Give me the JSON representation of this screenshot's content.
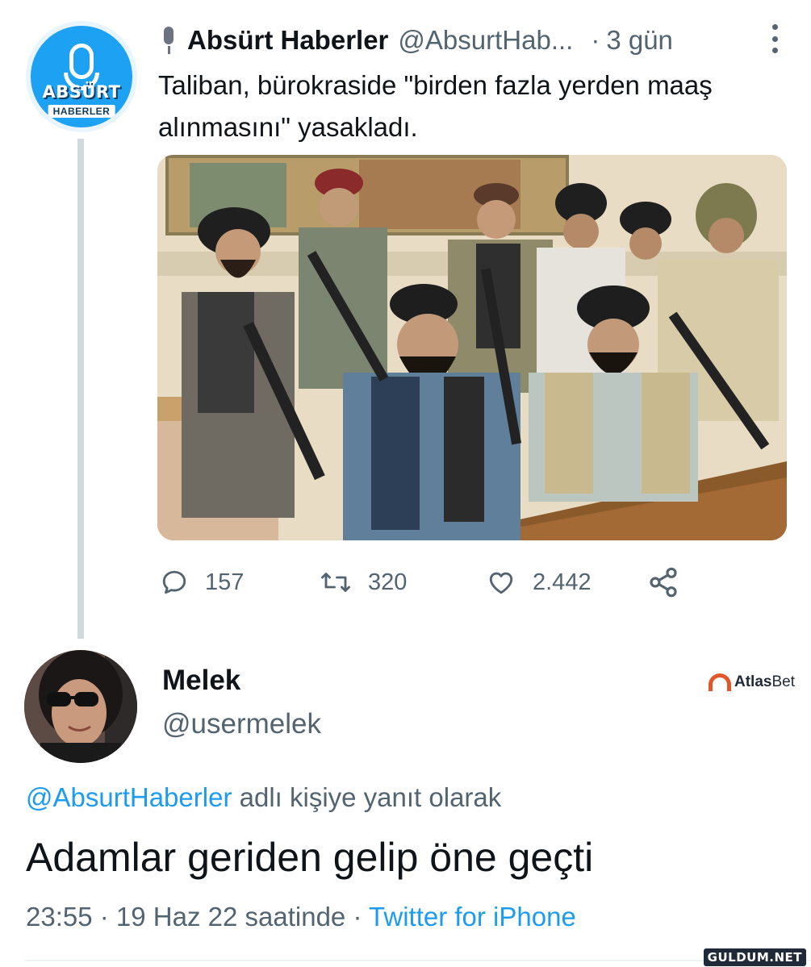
{
  "parent_tweet": {
    "author_name": "Absürt Haberler",
    "author_handle": "@AbsurtHab...",
    "time_separator": "·",
    "time_ago": "3 gün",
    "text": "Taliban, bürokraside \"birden fazla yerden maaş alınmasını\" yasakladı.",
    "avatar_logo_top": "ABSÜRT",
    "avatar_logo_bottom": "HABERLER",
    "actions": {
      "replies": "157",
      "retweets": "320",
      "likes": "2.442"
    }
  },
  "reply_tweet": {
    "author_name": "Melek",
    "author_handle": "@usermelek",
    "reply_to_mention": "@AbsurtHaberler",
    "reply_to_suffix": "adlı kişiye yanıt olarak",
    "text": "Adamlar geriden gelip öne geçti",
    "timestamp": "23:55 · 19 Haz 22 saatinde",
    "meta_separator": "·",
    "source": "Twitter for iPhone"
  },
  "brand_badge": {
    "part1": "Atlas",
    "part2": "Bet"
  },
  "watermark": "GULDUM.NET",
  "icons": {
    "reply": "reply-icon",
    "retweet": "retweet-icon",
    "like": "heart-icon",
    "share": "share-icon",
    "more": "more-icon"
  },
  "colors": {
    "link": "#1d9bf0",
    "secondary_text": "#536471",
    "primary_text": "#0f1419",
    "avatar_brand": "#1da1f2"
  }
}
